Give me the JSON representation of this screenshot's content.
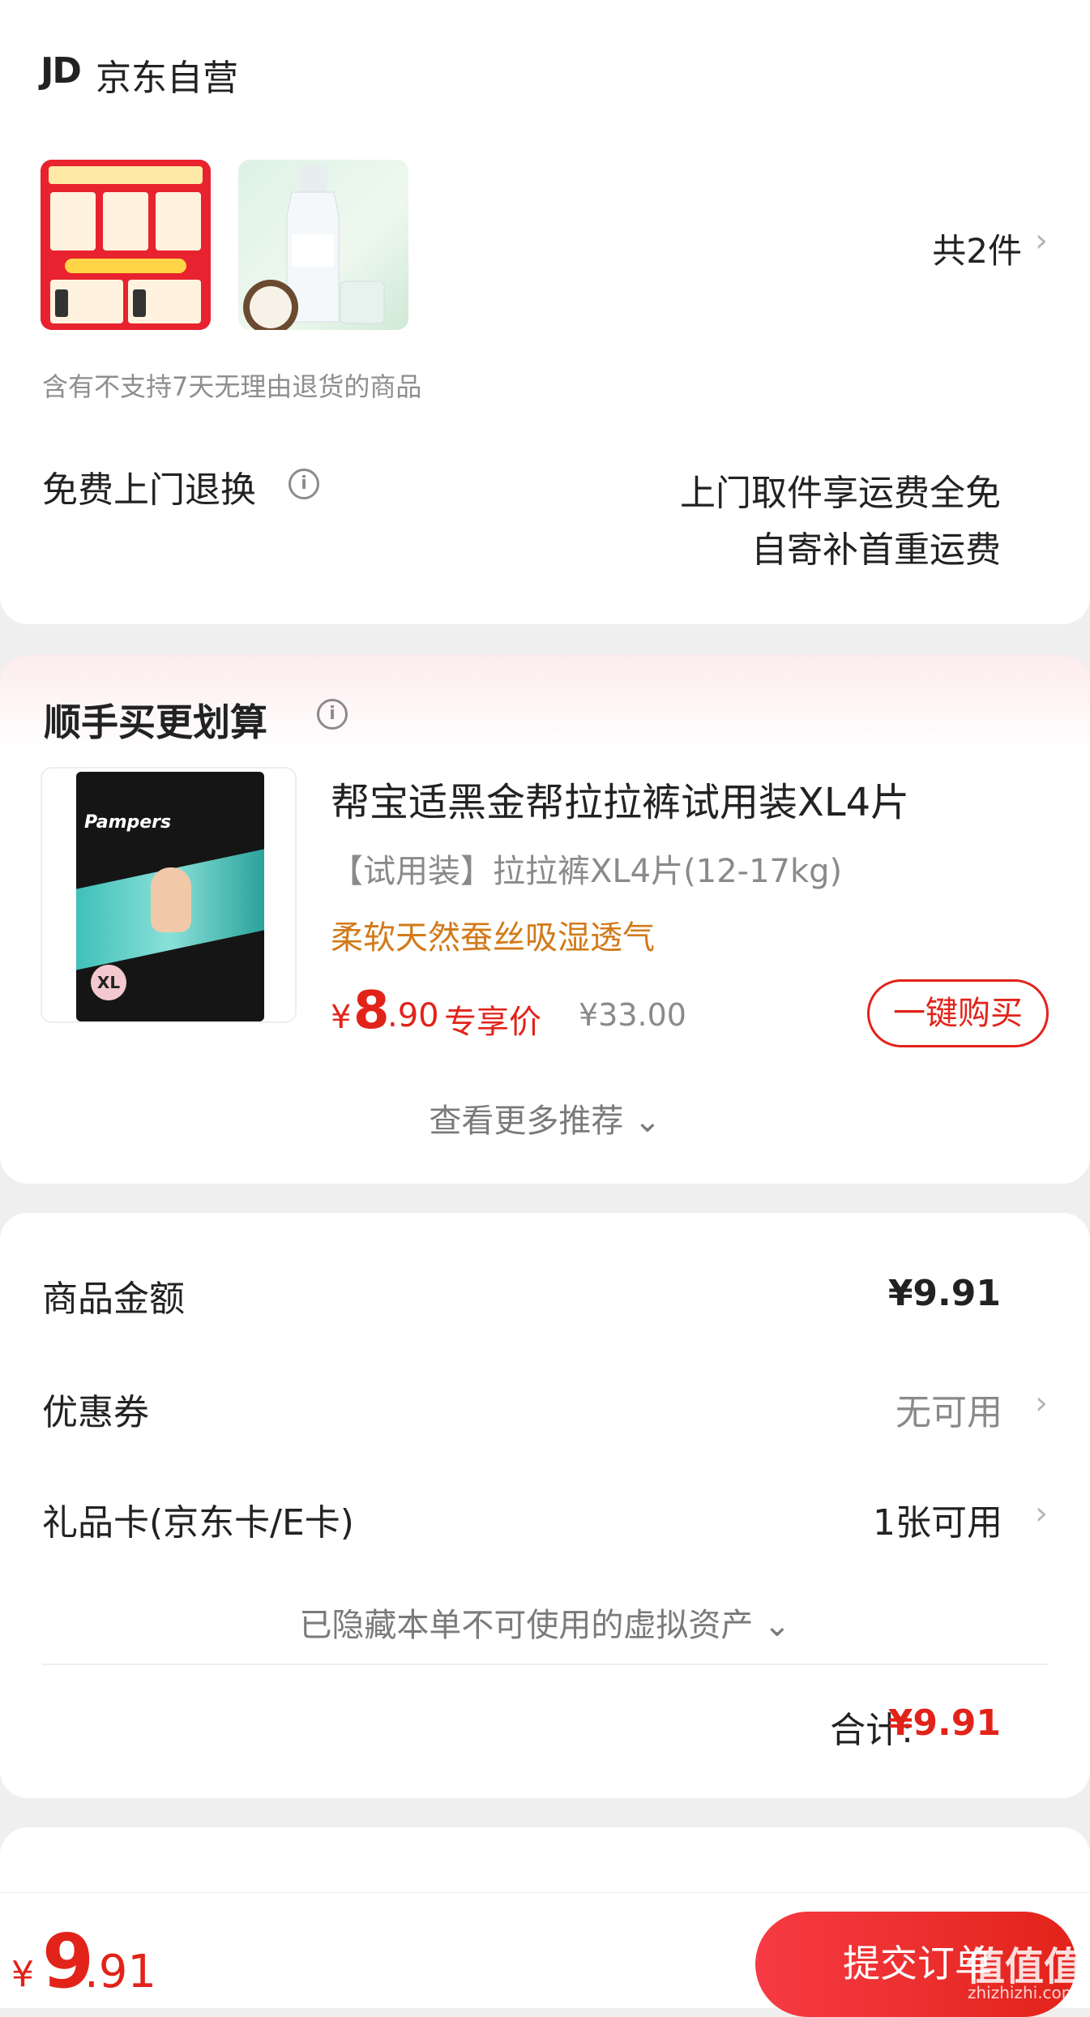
{
  "shop": {
    "logo_text": "JD",
    "name": "京东自营",
    "item_count": "共2件",
    "return_note": "含有不支持7天无理由退货的商品",
    "free_return_label": "免费上门退换",
    "pickup_line1": "上门取件享运费全免",
    "pickup_line2": "自寄补首重运费"
  },
  "recommend": {
    "title": "顺手买更划算",
    "product": {
      "title": "帮宝适黑金帮拉拉裤试用装XL4片",
      "spec": "【试用装】拉拉裤XL4片(12-17kg)",
      "feature": "柔软天然蚕丝吸湿透气",
      "price_symbol": "¥",
      "price_int": "8",
      "price_dec": ".90",
      "price_tag": "专享价",
      "price_original": "¥33.00",
      "buy_label": "一键购买",
      "image_brand": "Pampers",
      "image_size": "XL"
    },
    "more_label": "查看更多推荐 ⌄"
  },
  "summary": {
    "goods_amount_label": "商品金额",
    "goods_amount_value": "¥9.91",
    "coupon_label": "优惠券",
    "coupon_value": "无可用",
    "giftcard_label": "礼品卡(京东卡/E卡)",
    "giftcard_value": "1张可用",
    "hidden_assets": "已隐藏本单不可使用的虚拟资产 ⌄",
    "total_label": "合计:",
    "total_value": "¥9.91"
  },
  "bottom_bar": {
    "price_symbol": "¥",
    "price_int": "9",
    "price_dec": ".91",
    "submit_label": "提交订单",
    "watermark": "值值值",
    "watermark_url": "zhizhizhi.com"
  },
  "icons": {
    "chevron": "chevron-right-icon",
    "info": "info-icon"
  },
  "colors": {
    "accent_red": "#e2231a",
    "feature_orange": "#d27a1a",
    "muted_gray": "#8a8a8a"
  }
}
